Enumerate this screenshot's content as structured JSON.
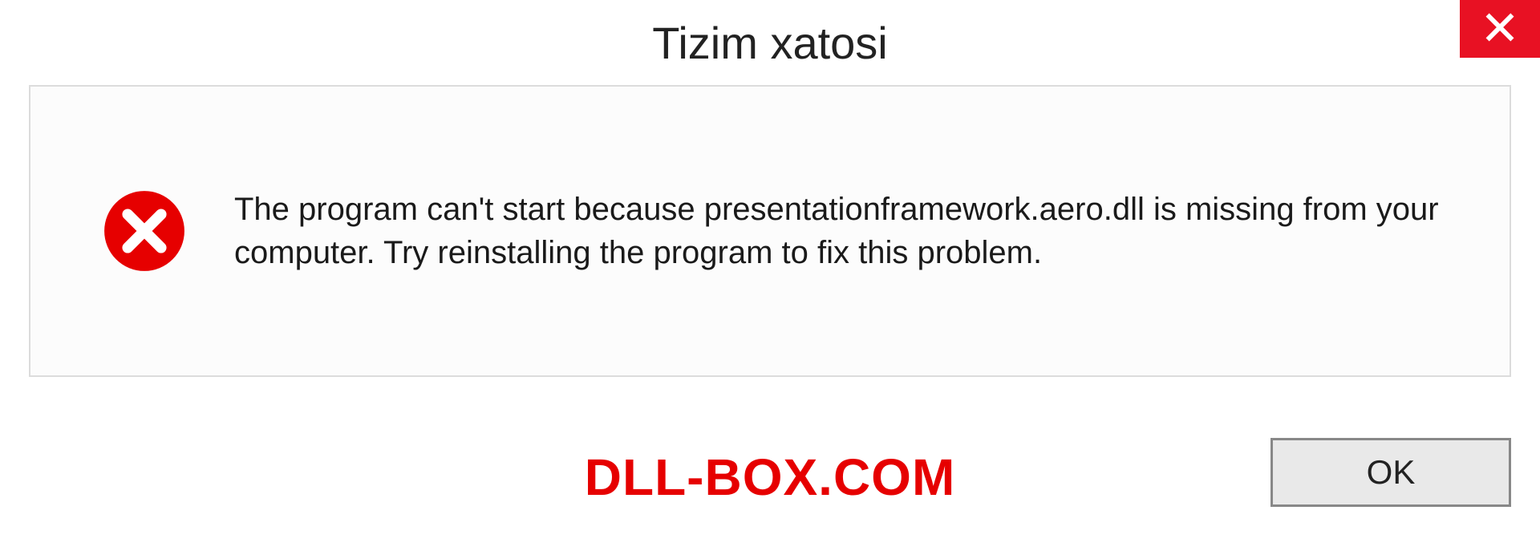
{
  "dialog": {
    "title": "Tizim xatosi",
    "message": "The program can't start because presentationframework.aero.dll is missing from your computer. Try reinstalling the program to fix this problem.",
    "ok_label": "OK"
  },
  "watermark": "DLL-BOX.COM",
  "icons": {
    "close": "close-icon",
    "error": "error-circle-icon"
  },
  "colors": {
    "close_bg": "#e81123",
    "error_red": "#e60000",
    "watermark_red": "#e60000"
  }
}
